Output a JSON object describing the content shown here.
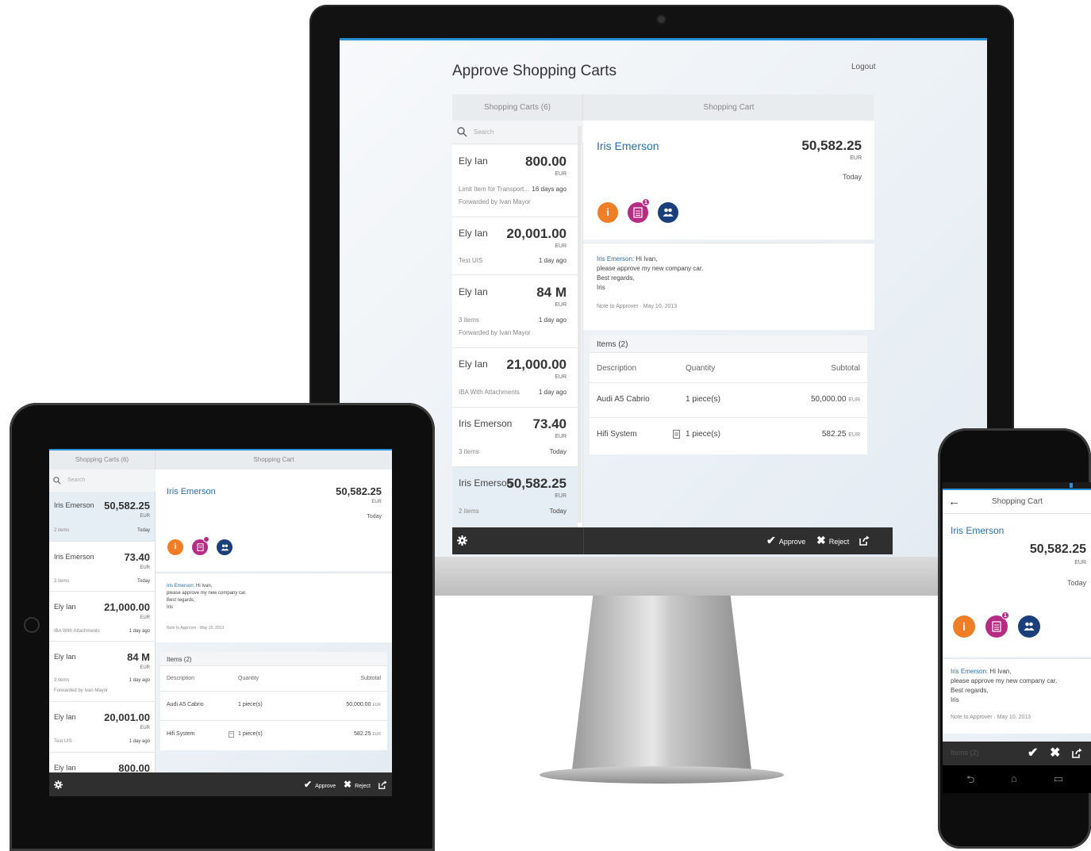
{
  "desktop": {
    "title": "Approve Shopping Carts",
    "logout": "Logout",
    "list_header": "Shopping Carts (6)",
    "detail_header": "Shopping Cart",
    "search_placeholder": "Search",
    "carts": [
      {
        "name": "Ely Ian",
        "amount": "800.00",
        "currency": "EUR",
        "sub": "Limit Item for Transport...",
        "time": "16 days ago",
        "fwd": "Forwarded by Ivan Mayor"
      },
      {
        "name": "Ely Ian",
        "amount": "20,001.00",
        "currency": "EUR",
        "sub": "Test UIS",
        "time": "1 day ago",
        "fwd": ""
      },
      {
        "name": "Ely Ian",
        "amount": "84 M",
        "currency": "EUR",
        "sub": "3 items",
        "time": "1 day ago",
        "fwd": "Forwarded by Ivan Mayor"
      },
      {
        "name": "Ely Ian",
        "amount": "21,000.00",
        "currency": "EUR",
        "sub": "IBA With Attachments",
        "time": "1 day ago",
        "fwd": ""
      },
      {
        "name": "Iris Emerson",
        "amount": "73.40",
        "currency": "EUR",
        "sub": "3 items",
        "time": "Today",
        "fwd": ""
      },
      {
        "name": "Iris Emerson",
        "amount": "50,582.25",
        "currency": "EUR",
        "sub": "2 items",
        "time": "Today",
        "fwd": ""
      }
    ],
    "detail": {
      "name": "Iris Emerson",
      "amount": "50,582.25",
      "currency": "EUR",
      "date": "Today",
      "icon_info": "i",
      "badge_count": "1",
      "note_sender": "Iris Emerson:",
      "note_line1": " Hi Ivan,",
      "note_line2": "please approve my new company car.",
      "note_line3": "Best regards,",
      "note_line4": "Iris",
      "note_meta": "Note to Approver  ·  May 10, 2013",
      "items_title": "Items (2)",
      "col_description": "Description",
      "col_quantity": "Quantity",
      "col_subtotal": "Subtotal",
      "items": [
        {
          "description": "Audi A5 Cabrio",
          "quantity": "1 piece(s)",
          "subtotal": "50,000.00",
          "currency": "EUR"
        },
        {
          "description": "Hifi System",
          "quantity": "1 piece(s)",
          "subtotal": "582.25",
          "currency": "EUR"
        }
      ]
    },
    "footer": {
      "approve": "Approve",
      "reject": "Reject"
    }
  },
  "tablet": {
    "list_header": "Shopping Carts (6)",
    "detail_header": "Shopping Cart",
    "search_placeholder": "Search",
    "carts": [
      {
        "name": "Iris Emerson",
        "amount": "50,582.25",
        "currency": "EUR",
        "sub": "2 items",
        "time": "Today",
        "fwd": ""
      },
      {
        "name": "Iris Emerson",
        "amount": "73.40",
        "currency": "EUR",
        "sub": "3 items",
        "time": "Today",
        "fwd": ""
      },
      {
        "name": "Ely Ian",
        "amount": "21,000.00",
        "currency": "EUR",
        "sub": "IBA With Attachments",
        "time": "1 day ago",
        "fwd": ""
      },
      {
        "name": "Ely Ian",
        "amount": "84 M",
        "currency": "EUR",
        "sub": "3 items",
        "time": "1 day ago",
        "fwd": "Forwarded by Ivan Mayor"
      },
      {
        "name": "Ely Ian",
        "amount": "20,001.00",
        "currency": "EUR",
        "sub": "Test UIS",
        "time": "1 day ago",
        "fwd": ""
      },
      {
        "name": "Ely Ian",
        "amount": "800.00",
        "currency": "",
        "sub": "",
        "time": "",
        "fwd": ""
      }
    ]
  },
  "phone": {
    "header": "Shopping Cart",
    "items_title": "Items (2)"
  }
}
